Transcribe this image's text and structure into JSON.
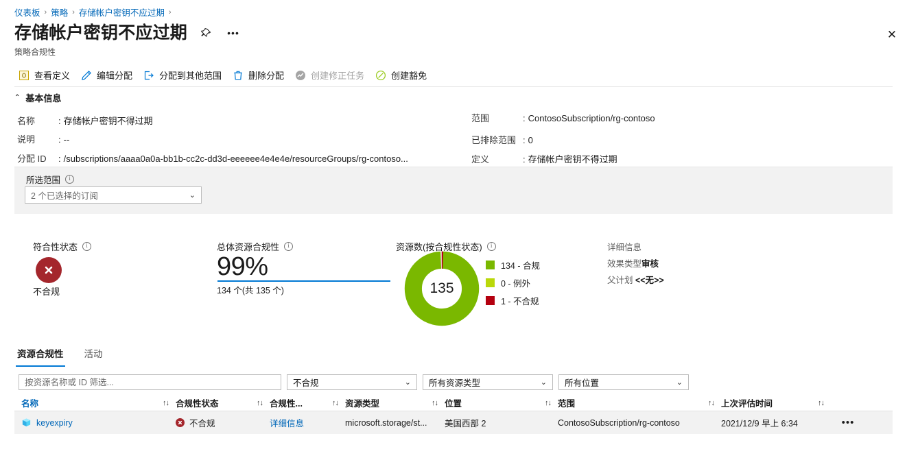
{
  "breadcrumb": {
    "items": [
      "仪表板",
      "策略",
      "存储帐户密钥不应过期"
    ],
    "separator": "›"
  },
  "header": {
    "title": "存储帐户密钥不应过期",
    "subtitle": "策略合规性",
    "pin_icon": "pin-icon",
    "more_icon": "ellipsis-icon",
    "close_icon": "close-icon",
    "close_glyph": "✕"
  },
  "commandbar": {
    "items": [
      {
        "label": "查看定义",
        "icon": "definition-icon",
        "disabled": false
      },
      {
        "label": "编辑分配",
        "icon": "pencil-icon",
        "disabled": false
      },
      {
        "label": "分配到其他范围",
        "icon": "assign-scope-icon",
        "disabled": false
      },
      {
        "label": "删除分配",
        "icon": "trash-icon",
        "disabled": false
      },
      {
        "label": "创建修正任务",
        "icon": "remediation-icon",
        "disabled": true
      },
      {
        "label": "创建豁免",
        "icon": "exemption-icon",
        "disabled": false
      }
    ]
  },
  "basics": {
    "section_title": "基本信息",
    "collapse_glyph": "⌃",
    "left": [
      {
        "key": "名称",
        "sep": ":",
        "value": "存储帐户密钥不得过期",
        "link": false
      },
      {
        "key": "说明",
        "sep": ":",
        "value": "--",
        "link": false
      },
      {
        "key": "分配 ID",
        "sep": ":",
        "value": "/subscriptions/aaaa0a0a-bb1b-cc2c-dd3d-eeeeee4e4e4e/resourceGroups/rg-contoso...",
        "link": false
      }
    ],
    "right": [
      {
        "key": "范围",
        "sep": ":",
        "value": "ContosoSubscription/rg-contoso",
        "link": false
      },
      {
        "key": "已排除范围",
        "sep": ":",
        "value": "0",
        "link": false
      },
      {
        "key": "定义",
        "sep": ":",
        "value": "存储帐户密钥不得过期",
        "link": false
      }
    ]
  },
  "scope": {
    "label": "所选范围",
    "info_glyph": "i",
    "selected": "2 个已选择的订阅",
    "caret_glyph": "⌄"
  },
  "metrics": {
    "compliance_state": {
      "label": "符合性状态",
      "status_text": "不合规",
      "status_icon": "error-circle-icon",
      "color": "#a4262c"
    },
    "overall": {
      "label": "总体资源合规性",
      "percent": "99%",
      "sub": "134 个(共 135 个)",
      "bar_color": "#0078d4"
    },
    "donut": {
      "label": "资源数(按合规性状态)",
      "total": "135",
      "legend": [
        {
          "text": "134 - 合规",
          "color": "#7ab800"
        },
        {
          "text": "0 - 例外",
          "color": "#bad80a"
        },
        {
          "text": "1 - 不合规",
          "color": "#b4000f"
        }
      ]
    },
    "details": {
      "title": "详细信息",
      "effect_label": "效果类型",
      "effect_value": "审核",
      "initiative_label": "父计划",
      "initiative_value": "<<无>>"
    }
  },
  "chart_data": {
    "type": "pie",
    "title": "资源数(按合规性状态)",
    "categories": [
      "合规",
      "例外",
      "不合规"
    ],
    "values": [
      134,
      0,
      1
    ],
    "colors": [
      "#7ab800",
      "#bad80a",
      "#b4000f"
    ],
    "total": 135,
    "center_label": "135",
    "legend": [
      "134 - 合规",
      "0 - 例外",
      "1 - 不合规"
    ],
    "legend_position": "right",
    "donut": true
  },
  "tabs": [
    {
      "label": "资源合规性",
      "active": true
    },
    {
      "label": "活动",
      "active": false
    }
  ],
  "filters": {
    "search_placeholder": "按资源名称或 ID 筛选...",
    "search_value": "",
    "compliance": "不合规",
    "resource_type": "所有资源类型",
    "location": "所有位置",
    "caret_glyph": "⌄"
  },
  "table": {
    "sort_glyph": "↑↓",
    "columns": [
      {
        "label": "名称",
        "link": true
      },
      {
        "label": "合规性状态",
        "link": false
      },
      {
        "label": "合规性...",
        "link": false
      },
      {
        "label": "资源类型",
        "link": false
      },
      {
        "label": "位置",
        "link": false
      },
      {
        "label": "范围",
        "link": false
      },
      {
        "label": "上次评估时间",
        "link": false
      }
    ],
    "rows": [
      {
        "name": "keyexpiry",
        "name_icon": "storage-account-icon",
        "state": "不合规",
        "state_icon": "error-circle-icon",
        "details": "详细信息",
        "resource_type": "microsoft.storage/st...",
        "location": "美国西部 2",
        "scope": "ContosoSubscription/rg-contoso",
        "last_evaluated": "2021/12/9 早上 6:34",
        "more_glyph": "•••"
      }
    ]
  }
}
